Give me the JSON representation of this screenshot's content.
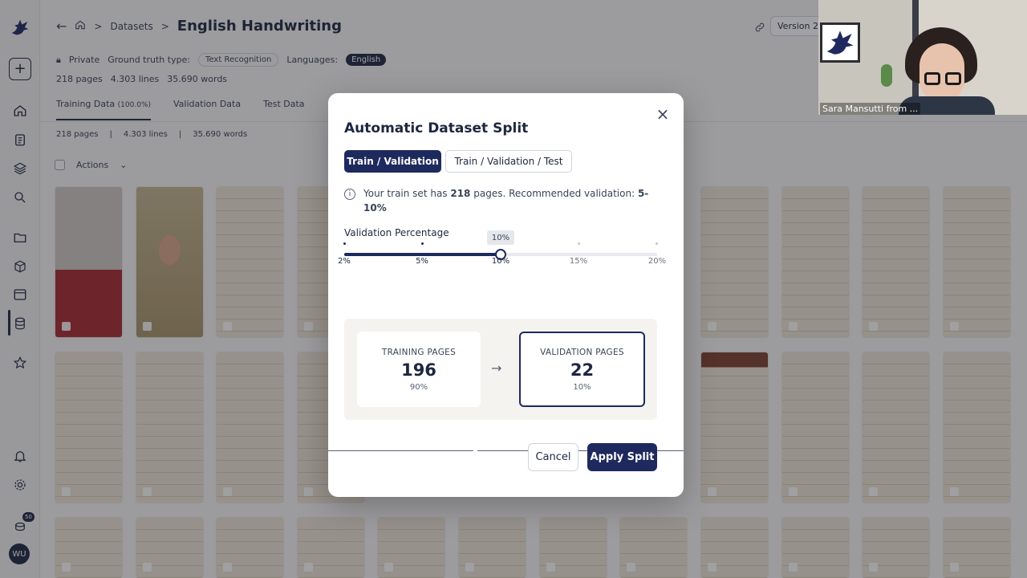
{
  "app": {
    "logo": "pegasus-logo"
  },
  "sidebar": {
    "icons": [
      "home-icon",
      "clipboard-icon",
      "layers-icon",
      "search-icon",
      "folder-icon",
      "cube-icon",
      "window-icon",
      "database-icon",
      "star-icon",
      "bell-icon",
      "gear-icon",
      "coins-icon"
    ],
    "add_label": "+",
    "credits_badge": "50",
    "avatar_initials": "WU"
  },
  "header": {
    "breadcrumb_datasets": "Datasets",
    "breadcrumb_sep": ">",
    "title": "English Handwriting",
    "version": "Version 2"
  },
  "meta": {
    "visibility": "Private",
    "gt_label": "Ground truth type:",
    "gt_value": "Text Recognition",
    "lang_label": "Languages:",
    "lang_value": "English",
    "pages": "218  pages",
    "lines": "4.303 lines",
    "words": "35.690 words"
  },
  "tabs": [
    {
      "label": "Training Data",
      "suffix": "(100.0%)"
    },
    {
      "label": "Validation Data"
    },
    {
      "label": "Test Data"
    }
  ],
  "stats": {
    "pages": "218 pages",
    "lines": "4.303 lines",
    "words": "35.690 words",
    "sep": "|"
  },
  "toolbar": {
    "actions_label": "Actions"
  },
  "modal": {
    "title": "Automatic Dataset Split",
    "close": "×",
    "mode_selected": "Train / Validation",
    "mode_other": "Train / Validation / Test",
    "info_text_1": "Your train set has ",
    "info_pages": "218",
    "info_text_2": " pages. Recommended validation: ",
    "info_range": "5-10%",
    "slider_label": "Validation Percentage",
    "slider_value_pct": 10,
    "slider_tooltip": "10%",
    "slider_ticks": [
      "2%",
      "5%",
      "10%",
      "15%",
      "20%"
    ],
    "training_label": "TRAINING PAGES",
    "training_count": "196",
    "training_pct": "90%",
    "validation_label": "VALIDATION PAGES",
    "validation_count": "22",
    "validation_pct": "10%",
    "arrow": "→",
    "cancel_label": "Cancel",
    "apply_label": "Apply Split"
  },
  "video": {
    "name": "Sara Mansutti from ..."
  },
  "colors": {
    "primary": "#1e2a5e",
    "accent_red": "#a8282e"
  }
}
